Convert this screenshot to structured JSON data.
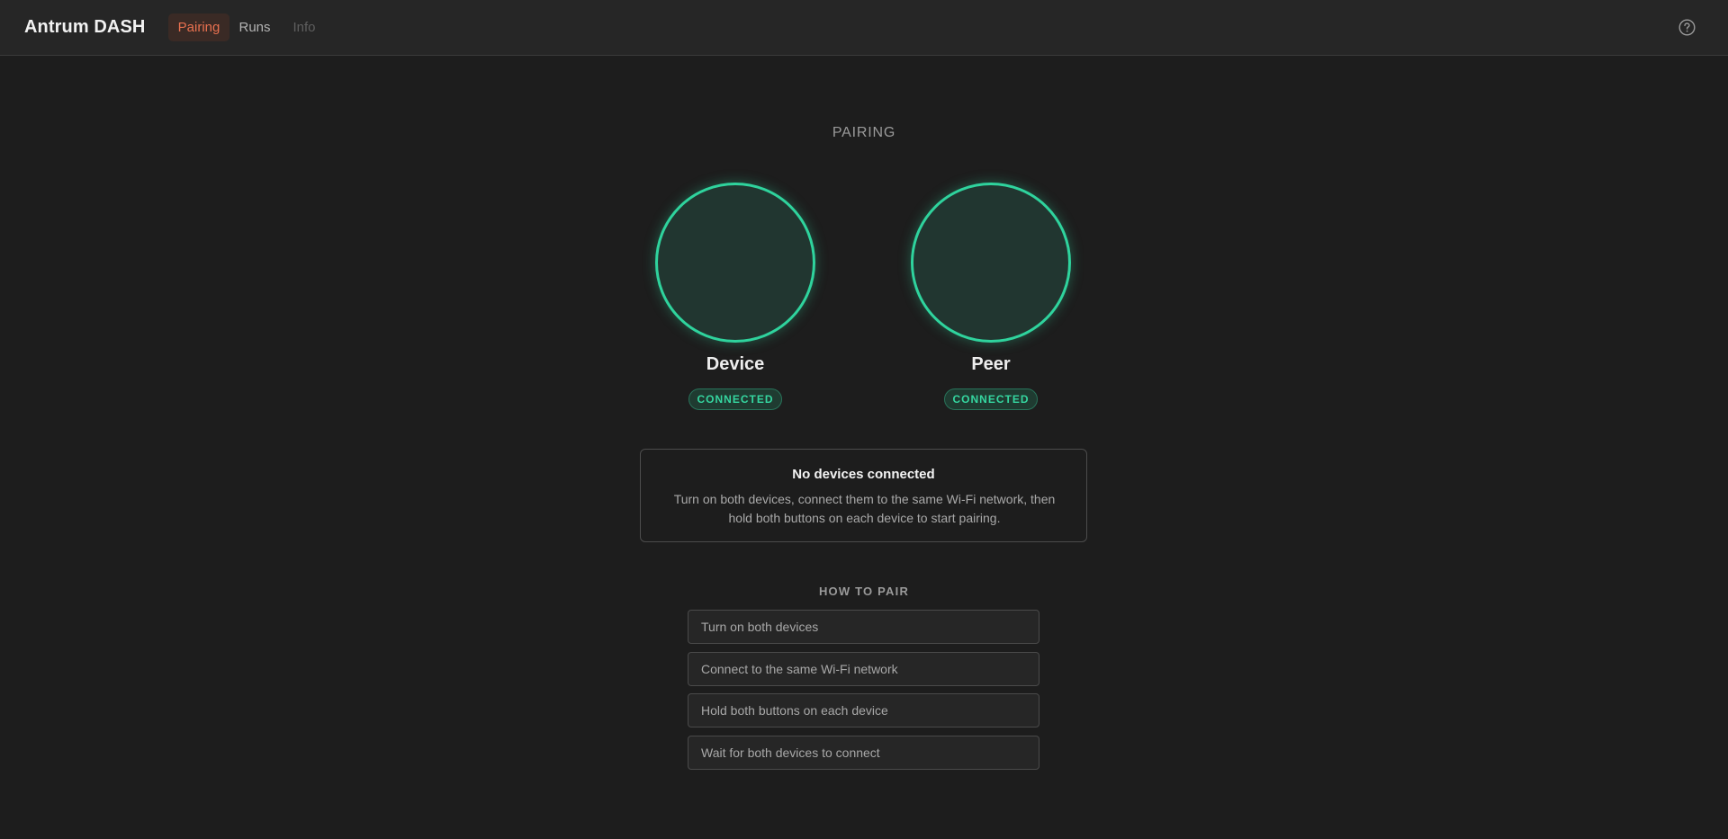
{
  "header": {
    "title": "Antrum DASH",
    "tabs": [
      {
        "label": "Pairing",
        "state": "active"
      },
      {
        "label": "Runs",
        "state": "normal"
      },
      {
        "label": "Info",
        "state": "disabled"
      }
    ],
    "help_icon": "help-circle-icon"
  },
  "pairing": {
    "title": "PAIRING",
    "nodes": [
      {
        "label": "Device",
        "status": "CONNECTED"
      },
      {
        "label": "Peer",
        "status": "CONNECTED"
      }
    ],
    "notice": {
      "title": "No devices connected",
      "body": "Turn on both devices, connect them to the same Wi-Fi network, then hold both buttons on each device to start pairing."
    },
    "how_to": {
      "title": "HOW TO PAIR",
      "steps": [
        "Turn on both devices",
        "Connect to the same Wi-Fi network",
        "Hold both buttons on each device",
        "Wait for both devices to connect"
      ]
    }
  },
  "colors": {
    "background": "#1d1d1d",
    "accent": "#e8704f",
    "connected": "#2fd39d"
  }
}
